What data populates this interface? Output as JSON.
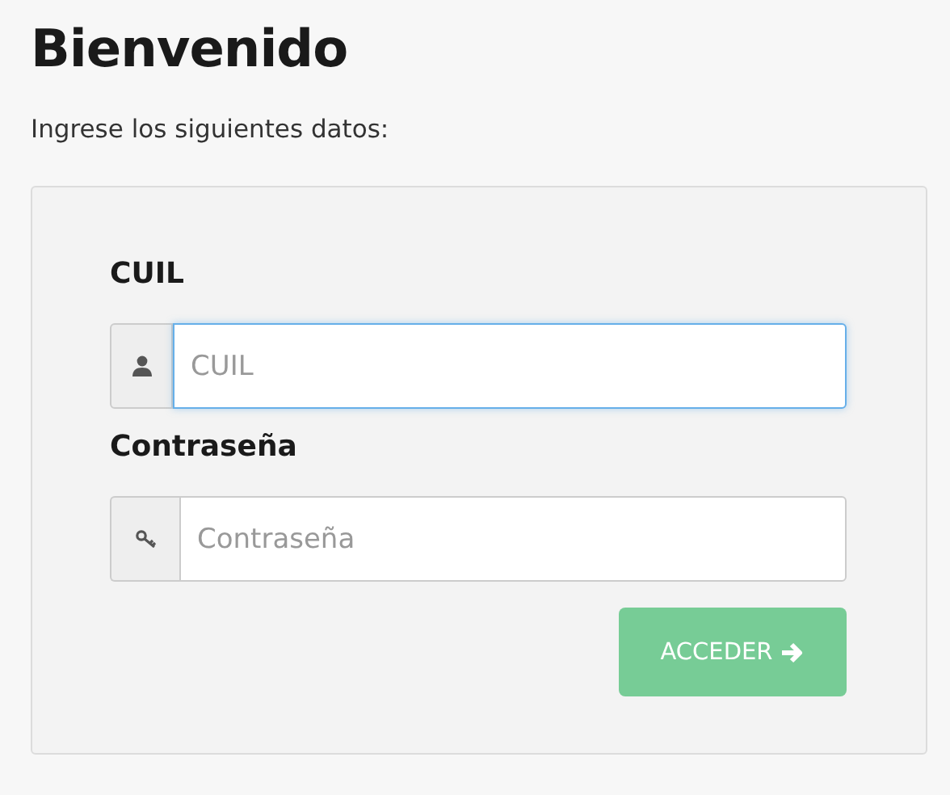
{
  "title": "Bienvenido",
  "subtitle": "Ingrese los siguientes datos:",
  "fields": [
    {
      "label": "CUIL",
      "placeholder": "CUIL",
      "kind": "user",
      "focused": true
    },
    {
      "label": "Contraseña",
      "placeholder": "Contraseña",
      "kind": "key",
      "focused": false
    }
  ],
  "submit": {
    "label": "ACCEDER"
  }
}
